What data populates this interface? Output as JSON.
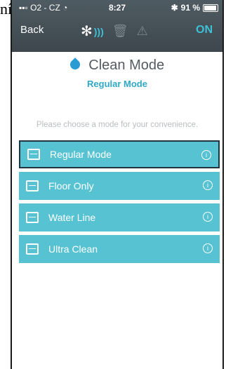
{
  "corner_text": "ní",
  "status": {
    "carrier": "O2 - CZ",
    "time": "8:27",
    "battery": "91 %"
  },
  "nav": {
    "back": "Back",
    "on": "ON"
  },
  "main": {
    "title": "Clean Mode",
    "subtitle": "Regular Mode",
    "prompt": "Please choose a mode for your convenience."
  },
  "modes": [
    {
      "label": "Regular Mode",
      "selected": true
    },
    {
      "label": "Floor Only",
      "selected": false
    },
    {
      "label": "Water Line",
      "selected": false
    },
    {
      "label": "Ultra Clean",
      "selected": false
    }
  ],
  "colors": {
    "accent": "#3ec0d6",
    "mode_bg": "#57c2d2",
    "appbar": "#4f5b62"
  }
}
